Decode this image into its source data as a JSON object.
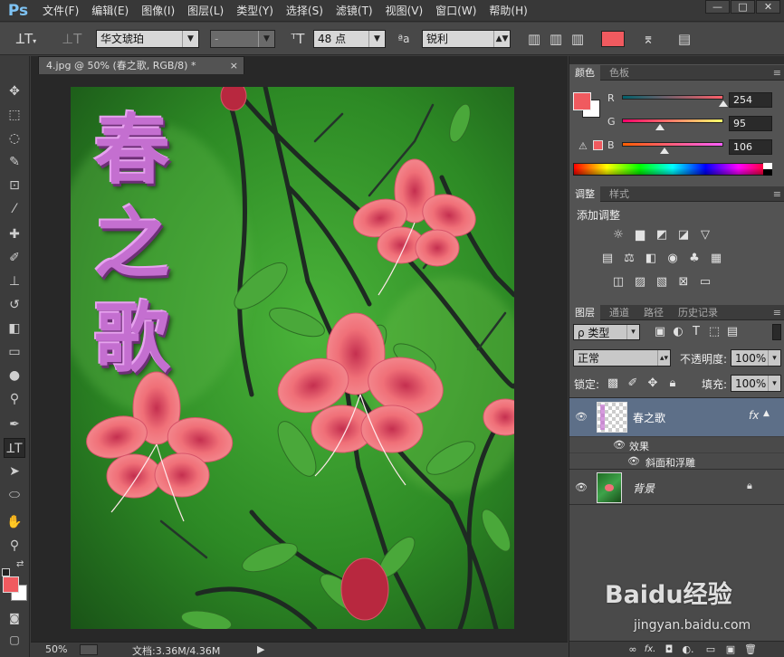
{
  "app": {
    "logo": "Ps"
  },
  "menubar": {
    "items": [
      "文件(F)",
      "编辑(E)",
      "图像(I)",
      "图层(L)",
      "类型(Y)",
      "选择(S)",
      "滤镜(T)",
      "视图(V)",
      "窗口(W)",
      "帮助(H)"
    ],
    "window_controls": [
      "—",
      "□",
      "✕"
    ]
  },
  "options": {
    "tool_icon": "type-tool-icon",
    "font_family": "华文琥珀",
    "font_style": "-",
    "font_size": "48 点",
    "aa_label": "ªa",
    "aa_mode": "锐利",
    "text_color": "#f05a5f"
  },
  "document": {
    "tab_label": "4.jpg @ 50% (春之歌, RGB/8) *",
    "tab_close": "×",
    "canvas_text": [
      "春",
      "之",
      "歌"
    ],
    "text_color": "#c46fd0"
  },
  "statusbar": {
    "zoom": "50%",
    "doc_info": "文档:3.36M/4.36M",
    "arrow": "▶"
  },
  "color_panel": {
    "tabs": [
      "颜色",
      "色板"
    ],
    "channels": [
      {
        "label": "R",
        "value": "254",
        "fraction": 0.996
      },
      {
        "label": "G",
        "value": "95",
        "fraction": 0.373
      },
      {
        "label": "B",
        "value": "106",
        "fraction": 0.416
      }
    ],
    "foreground": "#f05a5f",
    "background": "#ffffff"
  },
  "adjust_panel": {
    "tabs": [
      "调整",
      "样式"
    ],
    "title": "添加调整"
  },
  "layers_panel": {
    "tabs": [
      "图层",
      "通道",
      "路径",
      "历史记录"
    ],
    "filter_label": "ρ 类型",
    "blend_mode": "正常",
    "opacity_label": "不透明度:",
    "opacity": "100%",
    "lock_label": "锁定:",
    "fill_label": "填充:",
    "fill": "100%",
    "layers": [
      {
        "name": "春之歌",
        "fx": "fx",
        "effects_label": "效果",
        "effect": "斜面和浮雕"
      },
      {
        "name": "背景",
        "lock": "🔒"
      }
    ],
    "footer_icons": [
      "∞",
      "fx.",
      "◘",
      "◐.",
      "▭",
      "▣",
      "🗑"
    ]
  },
  "watermark": {
    "brand": "Baidu经验",
    "url": "jingyan.baidu.com"
  }
}
